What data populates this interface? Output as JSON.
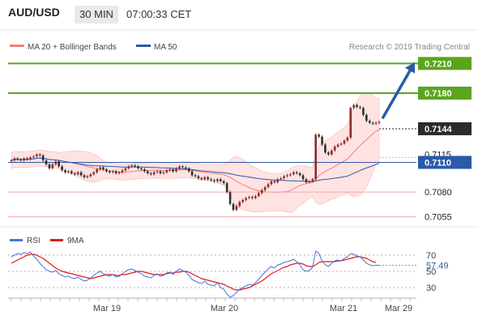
{
  "header": {
    "pair": "AUD/USD",
    "timeframe": "30 MIN",
    "timestamp": "07:00:33 CET"
  },
  "legend": {
    "ma20_label": "MA 20 + Bollinger Bands",
    "ma50_label": "MA 50",
    "copyright": "Research © 2019 Trading Central",
    "rsi_label": "RSI",
    "ma9_label": "9MA"
  },
  "colors": {
    "up_candle": "#8a2b27",
    "down_candle": "#2f2f2f",
    "ma20": "#f08080",
    "bollinger_fill": "#ffe3e3",
    "ma50": "#2a5aa8",
    "target_line": "#5aa51e",
    "support_line": "#f3a8a8",
    "current_line": "#2a5aa8",
    "arrow": "#2a5aa8",
    "rsi_line": "#4a74d8",
    "ma9_line": "#e01b1b"
  },
  "chart_data": [
    {
      "type": "candlestick",
      "ylim": [
        7.04,
        7.225
      ],
      "x_ticks": [
        "Mar 19",
        "Mar 20",
        "Mar 21",
        "Mar 29"
      ],
      "levels": [
        {
          "label": "0.7210",
          "value": 7.21,
          "kind": "target"
        },
        {
          "label": "0.7180",
          "value": 7.18,
          "kind": "target"
        },
        {
          "label": "0.7144",
          "value": 7.144,
          "kind": "current"
        },
        {
          "label": "0.7115",
          "value": 7.115,
          "kind": "plain"
        },
        {
          "label": "0.7110",
          "value": 7.11,
          "kind": "pivot"
        },
        {
          "label": "0.7080",
          "value": 7.08,
          "kind": "support"
        },
        {
          "label": "0.7055",
          "value": 7.055,
          "kind": "support"
        }
      ],
      "series": [
        {
          "values": [
            7.112,
            7.114,
            7.113,
            7.112,
            7.114,
            7.113,
            7.115,
            7.116,
            7.118,
            7.117,
            7.112,
            7.108,
            7.104,
            7.108,
            7.111,
            7.106,
            7.102,
            7.1,
            7.101,
            7.099,
            7.098,
            7.1,
            7.097,
            7.095,
            7.096,
            7.098,
            7.1,
            7.103,
            7.105,
            7.103,
            7.101,
            7.1,
            7.101,
            7.099,
            7.1,
            7.102,
            7.104,
            7.106,
            7.107,
            7.106,
            7.104,
            7.103,
            7.101,
            7.099,
            7.098,
            7.1,
            7.101,
            7.099,
            7.1,
            7.102,
            7.103,
            7.101,
            7.104,
            7.106,
            7.105,
            7.104,
            7.101,
            7.097,
            7.096,
            7.094,
            7.093,
            7.095,
            7.093,
            7.092,
            7.091,
            7.093,
            7.091,
            7.089,
            7.08,
            7.068,
            7.062,
            7.066,
            7.07,
            7.072,
            7.074,
            7.075,
            7.074,
            7.076,
            7.079,
            7.082,
            7.085,
            7.088,
            7.091,
            7.09,
            7.093,
            7.094,
            7.096,
            7.097,
            7.098,
            7.1,
            7.099,
            7.097,
            7.093,
            7.09,
            7.091,
            7.093,
            7.138,
            7.136,
            7.128,
            7.12,
            7.118,
            7.122,
            7.126,
            7.128,
            7.129,
            7.132,
            7.135,
            7.165,
            7.168,
            7.166,
            7.165,
            7.158,
            7.152,
            7.15,
            7.149,
            7.15,
            7.151
          ]
        }
      ]
    },
    {
      "type": "line",
      "ylim": [
        20,
        80
      ],
      "y_ticks": [
        70,
        50,
        30
      ],
      "current_label": "57.49",
      "series": [
        {
          "name": "RSI",
          "values": [
            68,
            70,
            72,
            71,
            73,
            72,
            74,
            69,
            65,
            60,
            56,
            52,
            50,
            49,
            51,
            47,
            45,
            43,
            44,
            42,
            41,
            43,
            40,
            38,
            39,
            42,
            45,
            48,
            50,
            47,
            45,
            44,
            46,
            43,
            44,
            47,
            50,
            52,
            53,
            51,
            49,
            47,
            44,
            43,
            42,
            45,
            47,
            44,
            45,
            48,
            49,
            46,
            50,
            53,
            51,
            49,
            45,
            40,
            38,
            36,
            35,
            38,
            34,
            33,
            32,
            36,
            30,
            28,
            22,
            18,
            20,
            24,
            28,
            30,
            32,
            34,
            33,
            36,
            40,
            45,
            49,
            53,
            56,
            54,
            58,
            59,
            61,
            62,
            63,
            65,
            62,
            58,
            52,
            50,
            51,
            55,
            75,
            72,
            63,
            58,
            56,
            60,
            63,
            64,
            63,
            66,
            68,
            72,
            71,
            69,
            68,
            64,
            60,
            58,
            57,
            57.5,
            57.49
          ]
        },
        {
          "name": "9MA",
          "values": [
            60,
            62,
            64,
            66,
            68,
            70,
            71,
            71,
            70,
            68,
            66,
            63,
            60,
            57,
            54,
            52,
            50,
            49,
            48,
            47,
            46,
            45,
            44,
            43,
            42,
            41,
            42,
            43,
            44,
            45,
            46,
            46,
            46,
            45,
            45,
            46,
            46,
            47,
            48,
            49,
            50,
            50,
            49,
            48,
            47,
            46,
            46,
            46,
            46,
            47,
            48,
            48,
            49,
            49,
            50,
            50,
            49,
            47,
            45,
            43,
            41,
            40,
            39,
            38,
            37,
            36,
            35,
            34,
            32,
            30,
            28,
            27,
            27,
            28,
            29,
            30,
            32,
            34,
            36,
            38,
            41,
            44,
            47,
            49,
            51,
            53,
            55,
            56,
            58,
            59,
            60,
            60,
            59,
            57,
            56,
            56,
            58,
            61,
            62,
            62,
            62,
            62,
            62,
            63,
            63,
            64,
            65,
            66,
            67,
            68,
            68,
            67,
            66,
            64,
            62,
            61
          ]
        }
      ]
    }
  ]
}
